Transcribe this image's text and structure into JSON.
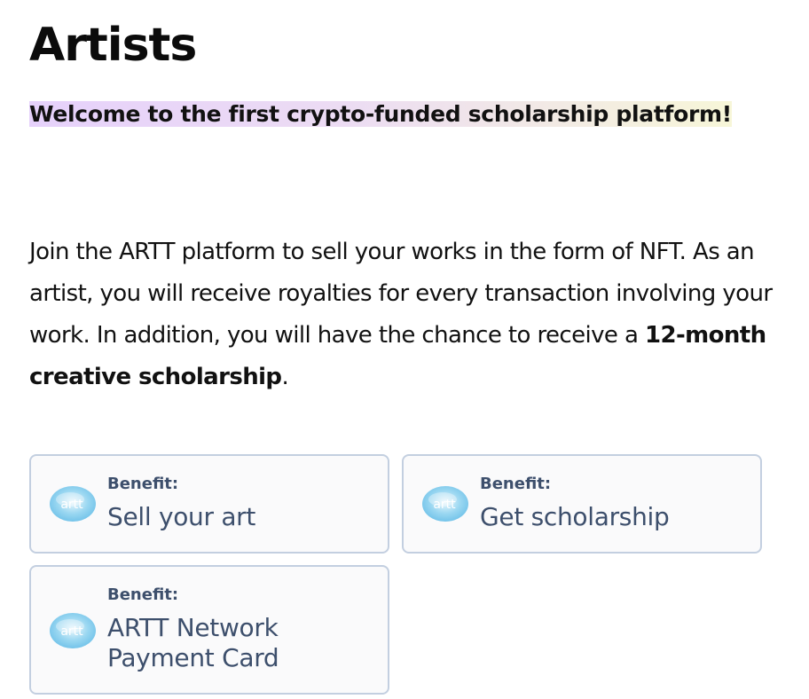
{
  "page": {
    "title": "Artists",
    "welcome": "Welcome to the first crypto-funded scholarship platform!",
    "intro": {
      "text": "Join the ARTT platform to sell your works in the form of NFT. As an artist, you will receive royalties for every transaction involving your work. In addition, you will have the chance to receive a ",
      "emphasis": "12-month creative scholarship",
      "ending": "."
    }
  },
  "benefits": [
    {
      "label": "Benefit:",
      "title": "Sell your art",
      "icon": "artt-logo-icon"
    },
    {
      "label": "Benefit:",
      "title": "Get scholarship",
      "icon": "artt-logo-icon"
    },
    {
      "label": "Benefit:",
      "title": "ARTT Network Payment Card",
      "icon": "artt-logo-icon"
    }
  ],
  "logo_text": "artt",
  "colors": {
    "card_border": "#c3cfe0",
    "card_text": "#3d4f6c",
    "highlight_start": "#e6d1fb",
    "highlight_end": "#f7f6d8",
    "logo_blue": "#6fc6ec"
  }
}
